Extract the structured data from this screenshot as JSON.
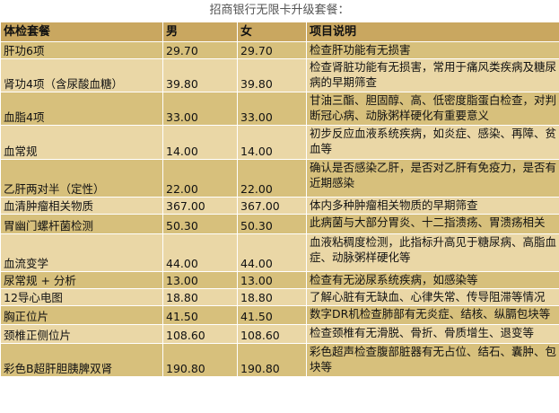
{
  "caption": "招商银行无限卡升级套餐：",
  "table": {
    "headers": [
      "体检套餐",
      "男",
      "女",
      "项目说明"
    ],
    "rows": [
      {
        "name": "肝功6项",
        "male": "29.70",
        "female": "29.70",
        "desc": "检查肝功能有无损害"
      },
      {
        "name": "肾功4项（含尿酸血糖）",
        "male": "39.80",
        "female": "39.80",
        "desc": "检查肾脏功能有无损害，常用于痛风类疾病及糖尿病的早期筛查"
      },
      {
        "name": "血脂4项",
        "male": "33.00",
        "female": "33.00",
        "desc": "甘油三酯、胆固醇、高、低密度脂蛋白检查，对判断冠心病、动脉粥样硬化有重要意义"
      },
      {
        "name": "血常规",
        "male": "14.00",
        "female": "14.00",
        "desc": "初步反应血液系统疾病，如炎症、感染、再障、贫血等"
      },
      {
        "name": "乙肝两对半（定性）",
        "male": "22.00",
        "female": "22.00",
        "desc": "确认是否感染乙肝，是否对乙肝有免疫力，是否有近期感染"
      },
      {
        "name": "血清肿瘤相关物质",
        "male": "367.00",
        "female": "367.00",
        "desc": "体内多种肿瘤相关物质的早期筛查"
      },
      {
        "name": "胃幽门螺杆菌检测",
        "male": "50.30",
        "female": "50.30",
        "desc": "此病菌与大部分胃炎、十二指溃疡、胃溃疡相关"
      },
      {
        "name": "血流变学",
        "male": "44.00",
        "female": "44.00",
        "desc": "血液粘稠度检测，此指标升高见于糖尿病、高脂血症、动脉粥样硬化等"
      },
      {
        "name": "尿常规 + 分析",
        "male": "13.00",
        "female": "13.00",
        "desc": "检查有无泌尿系统疾病，如感染等"
      },
      {
        "name": "12导心电图",
        "male": "18.80",
        "female": "18.80",
        "desc": "了解心脏有无缺血、心律失常、传导阻滞等情况"
      },
      {
        "name": "胸正位片",
        "male": "41.50",
        "female": "41.50",
        "desc": "数字DR机检查肺部有无炎症、结核、纵膈包块等"
      },
      {
        "name": "颈椎正侧位片",
        "male": "108.60",
        "female": "108.60",
        "desc": "检查颈椎有无滑脱、骨折、骨质增生、退变等"
      },
      {
        "name": "彩色B超肝胆胰脾双肾",
        "male": "190.80",
        "female": "190.80",
        "desc": "彩色超声检查腹部脏器有无占位、结石、囊肿、包块等"
      }
    ]
  }
}
